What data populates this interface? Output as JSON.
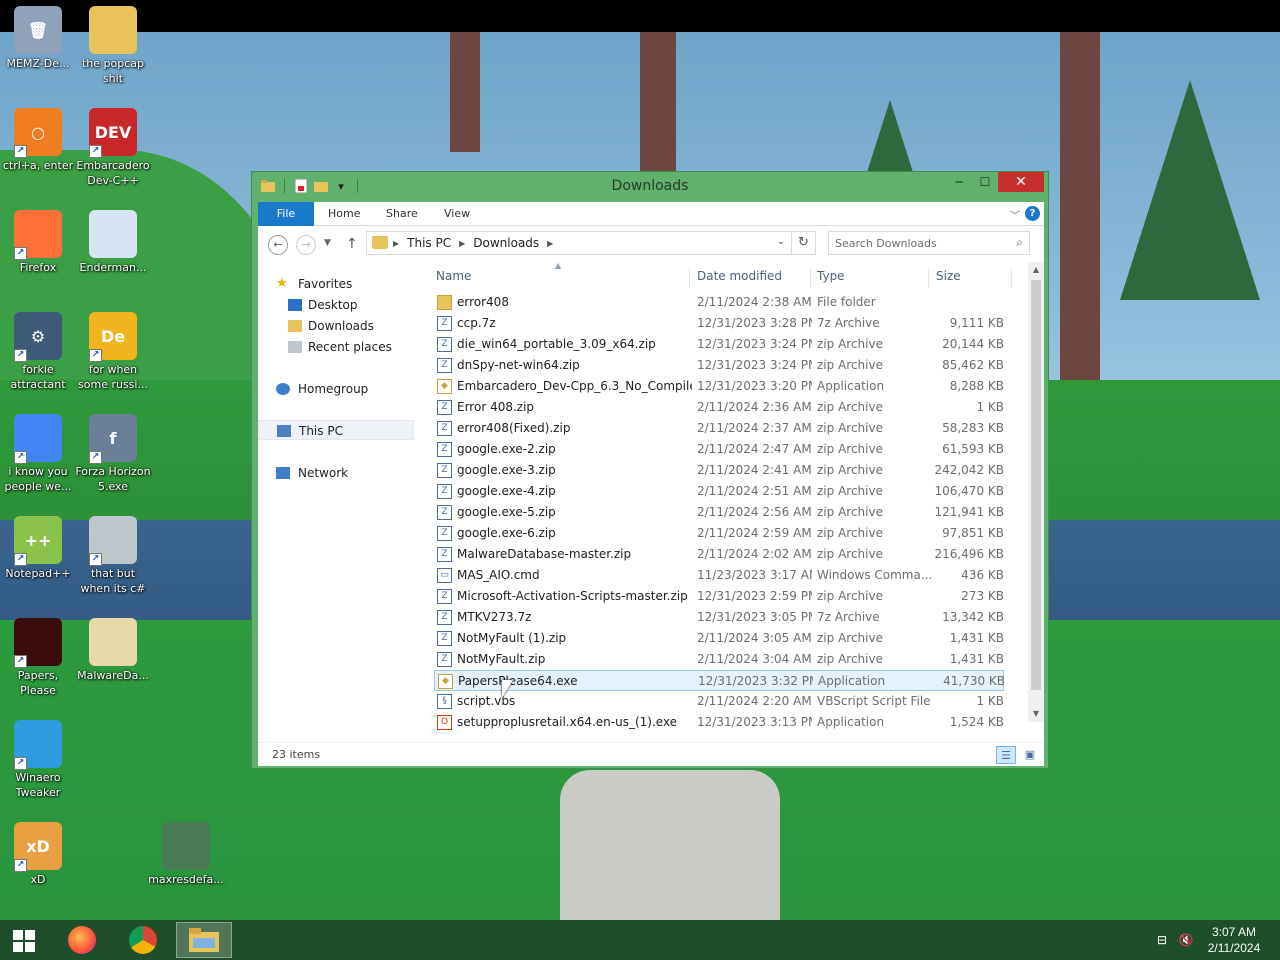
{
  "window": {
    "title": "Downloads",
    "ribbon_tabs": [
      "File",
      "Home",
      "Share",
      "View"
    ],
    "address": {
      "crumbs": [
        "This PC",
        "Downloads"
      ]
    },
    "search_placeholder": "Search Downloads",
    "columns": {
      "name": "Name",
      "date": "Date modified",
      "type": "Type",
      "size": "Size"
    },
    "status": "23 items",
    "accent": "#5fb16d",
    "selected_file": "PapersPlease64.exe"
  },
  "nav_pane": {
    "favorites": "Favorites",
    "desktop": "Desktop",
    "downloads": "Downloads",
    "recent": "Recent places",
    "homegroup": "Homegroup",
    "this_pc": "This PC",
    "network": "Network"
  },
  "files": [
    {
      "name": "error408",
      "date": "2/11/2024 2:38 AM",
      "type": "File folder",
      "size": "",
      "icon": "folder-icon"
    },
    {
      "name": "ccp.7z",
      "date": "12/31/2023 3:28 PM",
      "type": "7z Archive",
      "size": "9,111 KB",
      "icon": "archive-icon"
    },
    {
      "name": "die_win64_portable_3.09_x64.zip",
      "date": "12/31/2023 3:24 PM",
      "type": "zip Archive",
      "size": "20,144 KB",
      "icon": "archive-icon"
    },
    {
      "name": "dnSpy-net-win64.zip",
      "date": "12/31/2023 3:24 PM",
      "type": "zip Archive",
      "size": "85,462 KB",
      "icon": "archive-icon"
    },
    {
      "name": "Embarcadero_Dev-Cpp_6.3_No_Compiler...",
      "date": "12/31/2023 3:20 PM",
      "type": "Application",
      "size": "8,288 KB",
      "icon": "app-icon"
    },
    {
      "name": "Error 408.zip",
      "date": "2/11/2024 2:36 AM",
      "type": "zip Archive",
      "size": "1 KB",
      "icon": "archive-icon"
    },
    {
      "name": "error408(Fixed).zip",
      "date": "2/11/2024 2:37 AM",
      "type": "zip Archive",
      "size": "58,283 KB",
      "icon": "archive-icon"
    },
    {
      "name": "google.exe-2.zip",
      "date": "2/11/2024 2:47 AM",
      "type": "zip Archive",
      "size": "61,593 KB",
      "icon": "archive-icon"
    },
    {
      "name": "google.exe-3.zip",
      "date": "2/11/2024 2:41 AM",
      "type": "zip Archive",
      "size": "242,042 KB",
      "icon": "archive-icon"
    },
    {
      "name": "google.exe-4.zip",
      "date": "2/11/2024 2:51 AM",
      "type": "zip Archive",
      "size": "106,470 KB",
      "icon": "archive-icon"
    },
    {
      "name": "google.exe-5.zip",
      "date": "2/11/2024 2:56 AM",
      "type": "zip Archive",
      "size": "121,941 KB",
      "icon": "archive-icon"
    },
    {
      "name": "google.exe-6.zip",
      "date": "2/11/2024 2:59 AM",
      "type": "zip Archive",
      "size": "97,851 KB",
      "icon": "archive-icon"
    },
    {
      "name": "MalwareDatabase-master.zip",
      "date": "2/11/2024 2:02 AM",
      "type": "zip Archive",
      "size": "216,496 KB",
      "icon": "archive-icon"
    },
    {
      "name": "MAS_AIO.cmd",
      "date": "11/23/2023 3:17 AM",
      "type": "Windows Comma...",
      "size": "436 KB",
      "icon": "cmd-icon"
    },
    {
      "name": "Microsoft-Activation-Scripts-master.zip",
      "date": "12/31/2023 2:59 PM",
      "type": "zip Archive",
      "size": "273 KB",
      "icon": "archive-icon"
    },
    {
      "name": "MTKV273.7z",
      "date": "12/31/2023 3:05 PM",
      "type": "7z Archive",
      "size": "13,342 KB",
      "icon": "archive-icon"
    },
    {
      "name": "NotMyFault (1).zip",
      "date": "2/11/2024 3:05 AM",
      "type": "zip Archive",
      "size": "1,431 KB",
      "icon": "archive-icon"
    },
    {
      "name": "NotMyFault.zip",
      "date": "2/11/2024 3:04 AM",
      "type": "zip Archive",
      "size": "1,431 KB",
      "icon": "archive-icon"
    },
    {
      "name": "PapersPlease64.exe",
      "date": "12/31/2023 3:32 PM",
      "type": "Application",
      "size": "41,730 KB",
      "icon": "app-icon"
    },
    {
      "name": "script.vbs",
      "date": "2/11/2024 2:20 AM",
      "type": "VBScript Script File",
      "size": "1 KB",
      "icon": "script-icon"
    },
    {
      "name": "setupproplusretail.x64.en-us_(1).exe",
      "date": "12/31/2023 3:13 PM",
      "type": "Application",
      "size": "1,524 KB",
      "icon": "office-icon"
    }
  ],
  "desktop_icons": [
    {
      "label": "MEMZ-De...",
      "icon": "recycle-bin-icon",
      "color": "#8fa2b8",
      "glyph": "🗑"
    },
    {
      "label": "the popcap shit",
      "icon": "folder-icon",
      "color": "#e8c25a",
      "glyph": ""
    },
    {
      "label": "ctrl+a, enter",
      "icon": "magnifier-icon",
      "color": "#f07d20",
      "glyph": "○"
    },
    {
      "label": "Embarcadero Dev-C++",
      "icon": "devcpp-icon",
      "color": "#c62828",
      "glyph": "DEV"
    },
    {
      "label": "Firefox",
      "icon": "firefox-icon",
      "color": "#ff7139",
      "glyph": ""
    },
    {
      "label": "Enderman...",
      "icon": "window-icon",
      "color": "#d6e4f3",
      "glyph": ""
    },
    {
      "label": "forkie attractant",
      "icon": "settings-icon",
      "color": "#3e5a7a",
      "glyph": "⚙"
    },
    {
      "label": "for when some russi...",
      "icon": "dexpot-icon",
      "color": "#f2b41c",
      "glyph": "De"
    },
    {
      "label": "i know you people we...",
      "icon": "chrome-icon",
      "color": "#4285f4",
      "glyph": ""
    },
    {
      "label": "Forza Horizon 5.exe",
      "icon": "flash-icon",
      "color": "#6b7f97",
      "glyph": "f"
    },
    {
      "label": "Notepad++",
      "icon": "notepadpp-icon",
      "color": "#8bc34a",
      "glyph": "++"
    },
    {
      "label": "that but when its c#",
      "icon": "copy-icon",
      "color": "#bfc6ce",
      "glyph": ""
    },
    {
      "label": "Papers, Please",
      "icon": "papers-please-icon",
      "color": "#3a0d0d",
      "glyph": ""
    },
    {
      "label": "MalwareDa...",
      "icon": "folder-icon",
      "color": "#e8d9a8",
      "glyph": ""
    },
    {
      "label": "Winaero Tweaker",
      "icon": "winaero-icon",
      "color": "#2e9be0",
      "glyph": ""
    },
    {
      "label": "xD",
      "icon": "xd-icon",
      "color": "#e8a040",
      "glyph": "xD"
    },
    {
      "label": "maxresdefa...",
      "icon": "image-thumbnail-icon",
      "color": "#4a7a56",
      "glyph": ""
    }
  ],
  "taskbar": {
    "time": "3:07 AM",
    "date": "2/11/2024"
  }
}
